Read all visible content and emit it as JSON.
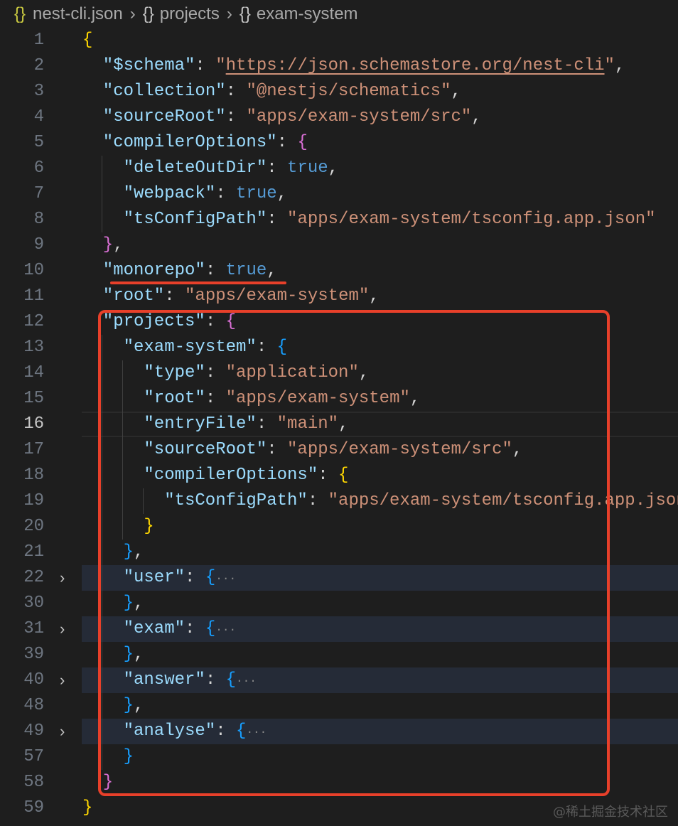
{
  "breadcrumb": {
    "icon": "{}",
    "items": [
      "nest-cli.json",
      "projects",
      "exam-system"
    ]
  },
  "watermark": "@稀土掘金技术社区",
  "annotation_color": "#e8402a",
  "lines": [
    {
      "n": "1",
      "i": 0,
      "t": [
        [
          "{",
          "y"
        ]
      ]
    },
    {
      "n": "2",
      "i": 1,
      "t": [
        [
          "\"$schema\"",
          "k"
        ],
        [
          ": ",
          "p"
        ],
        [
          "\"",
          "s"
        ],
        [
          "https://json.schemastore.org/nest-cli",
          "u"
        ],
        [
          "\"",
          "s"
        ],
        [
          ",",
          "p"
        ]
      ]
    },
    {
      "n": "3",
      "i": 1,
      "t": [
        [
          "\"collection\"",
          "k"
        ],
        [
          ": ",
          "p"
        ],
        [
          "\"@nestjs/schematics\"",
          "s"
        ],
        [
          ",",
          "p"
        ]
      ]
    },
    {
      "n": "4",
      "i": 1,
      "t": [
        [
          "\"sourceRoot\"",
          "k"
        ],
        [
          ": ",
          "p"
        ],
        [
          "\"apps/exam-system/src\"",
          "s"
        ],
        [
          ",",
          "p"
        ]
      ]
    },
    {
      "n": "5",
      "i": 1,
      "t": [
        [
          "\"compilerOptions\"",
          "k"
        ],
        [
          ": ",
          "p"
        ],
        [
          "{",
          "m"
        ]
      ]
    },
    {
      "n": "6",
      "i": 2,
      "t": [
        [
          "\"deleteOutDir\"",
          "k"
        ],
        [
          ": ",
          "p"
        ],
        [
          "true",
          "b"
        ],
        [
          ",",
          "p"
        ]
      ]
    },
    {
      "n": "7",
      "i": 2,
      "t": [
        [
          "\"webpack\"",
          "k"
        ],
        [
          ": ",
          "p"
        ],
        [
          "true",
          "b"
        ],
        [
          ",",
          "p"
        ]
      ]
    },
    {
      "n": "8",
      "i": 2,
      "t": [
        [
          "\"tsConfigPath\"",
          "k"
        ],
        [
          ": ",
          "p"
        ],
        [
          "\"apps/exam-system/tsconfig.app.json\"",
          "s"
        ]
      ]
    },
    {
      "n": "9",
      "i": 1,
      "t": [
        [
          "}",
          "m"
        ],
        [
          ",",
          "p"
        ]
      ]
    },
    {
      "n": "10",
      "i": 1,
      "t": [
        [
          "\"monorepo\"",
          "k"
        ],
        [
          ": ",
          "p"
        ],
        [
          "true",
          "b"
        ],
        [
          ",",
          "p"
        ]
      ]
    },
    {
      "n": "11",
      "i": 1,
      "t": [
        [
          "\"root\"",
          "k"
        ],
        [
          ": ",
          "p"
        ],
        [
          "\"apps/exam-system\"",
          "s"
        ],
        [
          ",",
          "p"
        ]
      ]
    },
    {
      "n": "12",
      "i": 1,
      "t": [
        [
          "\"projects\"",
          "k"
        ],
        [
          ": ",
          "p"
        ],
        [
          "{",
          "m"
        ]
      ]
    },
    {
      "n": "13",
      "i": 2,
      "t": [
        [
          "\"exam-system\"",
          "k"
        ],
        [
          ": ",
          "p"
        ],
        [
          "{",
          "l"
        ]
      ]
    },
    {
      "n": "14",
      "i": 3,
      "t": [
        [
          "\"type\"",
          "k"
        ],
        [
          ": ",
          "p"
        ],
        [
          "\"application\"",
          "s"
        ],
        [
          ",",
          "p"
        ]
      ]
    },
    {
      "n": "15",
      "i": 3,
      "t": [
        [
          "\"root\"",
          "k"
        ],
        [
          ": ",
          "p"
        ],
        [
          "\"apps/exam-system\"",
          "s"
        ],
        [
          ",",
          "p"
        ]
      ]
    },
    {
      "n": "16",
      "i": 3,
      "current": true,
      "t": [
        [
          "\"entryFile\"",
          "k"
        ],
        [
          ": ",
          "p"
        ],
        [
          "\"main\"",
          "s"
        ],
        [
          ",",
          "p"
        ]
      ]
    },
    {
      "n": "17",
      "i": 3,
      "t": [
        [
          "\"sourceRoot\"",
          "k"
        ],
        [
          ": ",
          "p"
        ],
        [
          "\"apps/exam-system/src\"",
          "s"
        ],
        [
          ",",
          "p"
        ]
      ]
    },
    {
      "n": "18",
      "i": 3,
      "t": [
        [
          "\"compilerOptions\"",
          "k"
        ],
        [
          ": ",
          "p"
        ],
        [
          "{",
          "y"
        ]
      ]
    },
    {
      "n": "19",
      "i": 4,
      "t": [
        [
          "\"tsConfigPath\"",
          "k"
        ],
        [
          ": ",
          "p"
        ],
        [
          "\"apps/exam-system/tsconfig.app.json\"",
          "s"
        ]
      ]
    },
    {
      "n": "20",
      "i": 3,
      "t": [
        [
          "}",
          "y"
        ]
      ]
    },
    {
      "n": "21",
      "i": 2,
      "t": [
        [
          "}",
          "l"
        ],
        [
          ",",
          "p"
        ]
      ]
    },
    {
      "n": "22",
      "i": 2,
      "folded": true,
      "t": [
        [
          "\"user\"",
          "k"
        ],
        [
          ": ",
          "p"
        ],
        [
          "{",
          "l"
        ],
        [
          "···",
          "e"
        ]
      ]
    },
    {
      "n": "30",
      "i": 2,
      "t": [
        [
          "}",
          "l"
        ],
        [
          ",",
          "p"
        ]
      ]
    },
    {
      "n": "31",
      "i": 2,
      "folded": true,
      "t": [
        [
          "\"exam\"",
          "k"
        ],
        [
          ": ",
          "p"
        ],
        [
          "{",
          "l"
        ],
        [
          "···",
          "e"
        ]
      ]
    },
    {
      "n": "39",
      "i": 2,
      "t": [
        [
          "}",
          "l"
        ],
        [
          ",",
          "p"
        ]
      ]
    },
    {
      "n": "40",
      "i": 2,
      "folded": true,
      "t": [
        [
          "\"answer\"",
          "k"
        ],
        [
          ": ",
          "p"
        ],
        [
          "{",
          "l"
        ],
        [
          "···",
          "e"
        ]
      ]
    },
    {
      "n": "48",
      "i": 2,
      "t": [
        [
          "}",
          "l"
        ],
        [
          ",",
          "p"
        ]
      ]
    },
    {
      "n": "49",
      "i": 2,
      "folded": true,
      "t": [
        [
          "\"analyse\"",
          "k"
        ],
        [
          ": ",
          "p"
        ],
        [
          "{",
          "l"
        ],
        [
          "···",
          "e"
        ]
      ]
    },
    {
      "n": "57",
      "i": 2,
      "t": [
        [
          "}",
          "l"
        ]
      ]
    },
    {
      "n": "58",
      "i": 1,
      "t": [
        [
          "}",
          "m"
        ]
      ]
    },
    {
      "n": "59",
      "i": 0,
      "t": [
        [
          "}",
          "y"
        ]
      ]
    }
  ]
}
